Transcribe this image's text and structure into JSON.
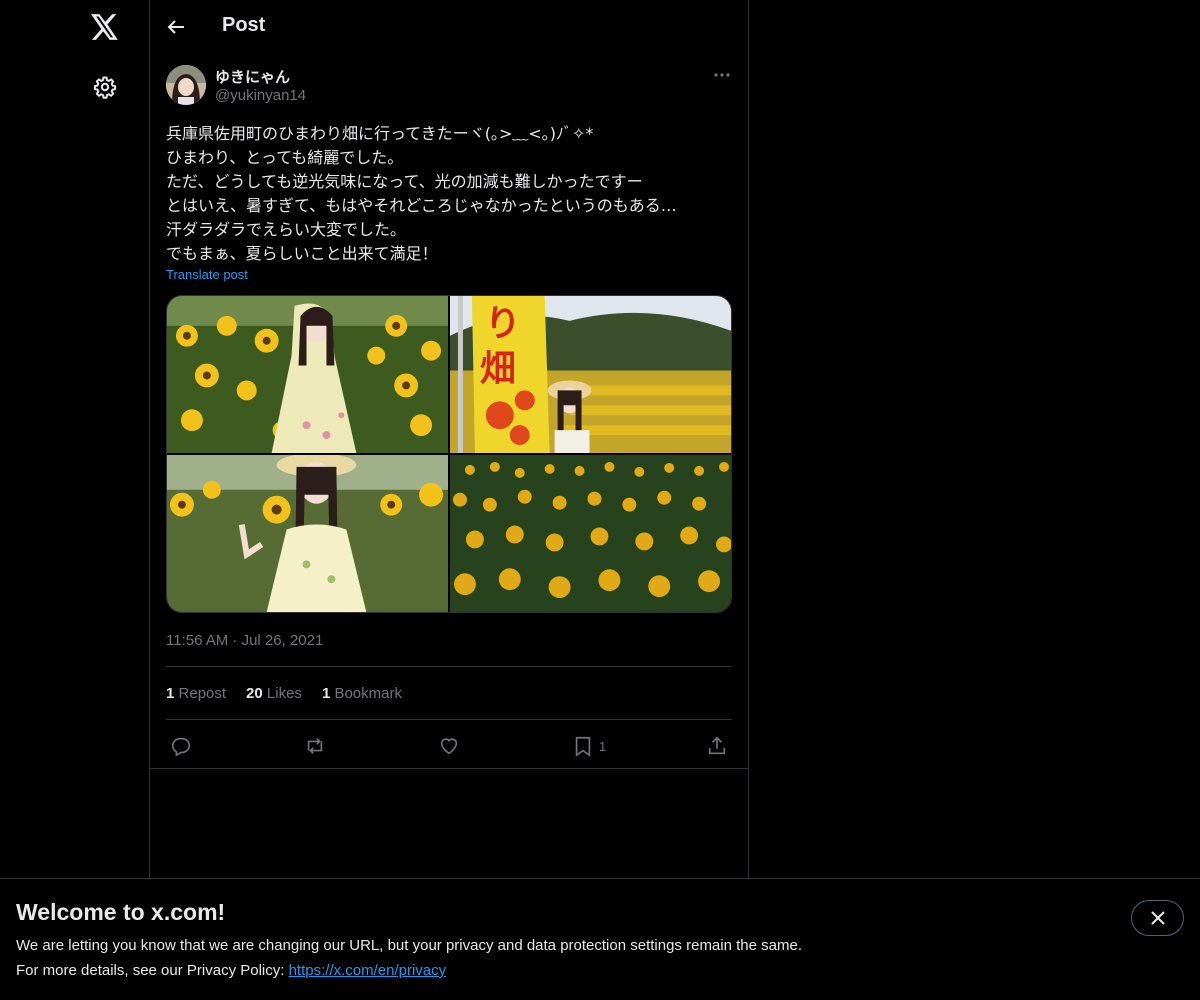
{
  "header": {
    "title": "Post"
  },
  "author": {
    "display_name": "ゆきにゃん",
    "handle": "@yukinyan14"
  },
  "post": {
    "text": "兵庫県佐用町のひまわり畑に行ってきたーヾ(｡>﹏<｡)ﾉﾞ✧*\nひまわり、とっても綺麗でした。\nただ、どうしても逆光気味になって、光の加減も難しかったですー\nとはいえ、暑すぎて、もはやそれどころじゃなかったというのもある…\n汗ダラダラでえらい大変でした。\nでもまぁ、夏らしいこと出来て満足！",
    "translate_label": "Translate post",
    "timestamp": "11:56 AM · Jul 26, 2021"
  },
  "stats": {
    "reposts_count": "1",
    "reposts_label": "Repost",
    "likes_count": "20",
    "likes_label": "Likes",
    "bookmarks_count": "1",
    "bookmarks_label": "Bookmark"
  },
  "actions": {
    "bookmark_count": "1"
  },
  "banner": {
    "title": "Welcome to x.com!",
    "line1": "We are letting you know that we are changing our URL, but your privacy and data protection settings remain the same.",
    "line2_prefix": "For more details, see our Privacy Policy: ",
    "link": "https://x.com/en/privacy"
  },
  "colors": {
    "background": "#000000",
    "text": "#e7e9ea",
    "muted": "#71767b",
    "accent": "#1d9bf0",
    "border": "#2f3336"
  },
  "icons": [
    "x-logo-icon",
    "gear-icon",
    "back-arrow-icon",
    "more-dots-icon",
    "reply-icon",
    "repost-icon",
    "like-icon",
    "bookmark-icon",
    "share-icon",
    "close-icon"
  ]
}
